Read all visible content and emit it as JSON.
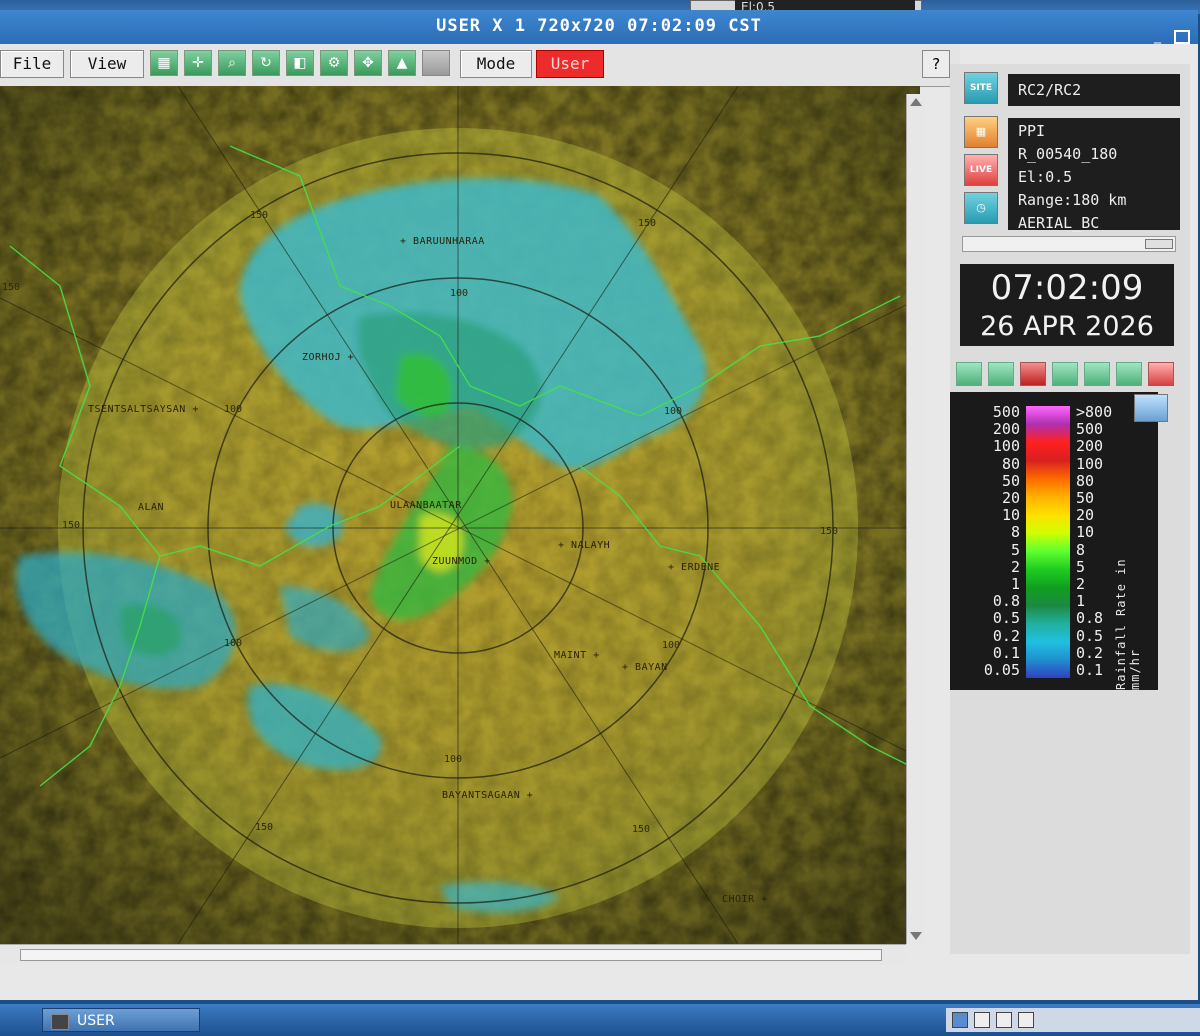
{
  "background": {
    "window_hint": "El:0.5"
  },
  "window": {
    "title": "USER  X 1  720x720   07:02:09 CST"
  },
  "toolbar": {
    "file_label": "File",
    "view_label": "View",
    "mode_label": "Mode",
    "mode_value": "User",
    "help_label": "?",
    "tool_icons": [
      "layers-icon",
      "crosshair-icon",
      "zoom-icon",
      "loop-icon",
      "overlay-icon",
      "measure-icon",
      "pan-icon",
      "terrain-icon",
      "blank-icon"
    ]
  },
  "map": {
    "range_rings": [
      {
        "label": "150",
        "pos": "nw"
      },
      {
        "label": "150",
        "pos": "ne"
      },
      {
        "label": "150",
        "pos": "w"
      },
      {
        "label": "150",
        "pos": "e"
      },
      {
        "label": "150",
        "pos": "sw"
      },
      {
        "label": "150",
        "pos": "se"
      },
      {
        "label": "100",
        "pos": "n"
      },
      {
        "label": "100",
        "pos": "w"
      },
      {
        "label": "100",
        "pos": "e"
      },
      {
        "label": "100",
        "pos": "sw"
      },
      {
        "label": "100",
        "pos": "se"
      },
      {
        "label": "100",
        "pos": "s"
      },
      {
        "label": "150",
        "pos": "far-w"
      }
    ],
    "cities": [
      {
        "name": "BARUUNHARAA"
      },
      {
        "name": "ZORHOJ"
      },
      {
        "name": "TSENTSALTSAYSAN"
      },
      {
        "name": "ALAN"
      },
      {
        "name": "ULAANBAATAR"
      },
      {
        "name": "ZUUNMOD"
      },
      {
        "name": "NALAYH"
      },
      {
        "name": "ERDENE"
      },
      {
        "name": "MAINT"
      },
      {
        "name": "BAYAN"
      },
      {
        "name": "BAYANTSAGAAN"
      },
      {
        "name": "CHOIR"
      }
    ]
  },
  "panel": {
    "product": "RC2/RC2",
    "info": [
      "PPI",
      "R_00540_180",
      "El:0.5",
      "Range:180 km",
      "AERIAL_BC"
    ],
    "clock_time": "07:02:09",
    "clock_date": "26 APR 2026",
    "icon_labels": {
      "site": "SITE",
      "live": "LIVE"
    },
    "controls": [
      "play-back-icon",
      "play-icon",
      "stop-icon",
      "step-back-icon",
      "step-forward-icon",
      "top-icon",
      "exit-icon"
    ]
  },
  "legend": {
    "left_values": [
      "500",
      "200",
      "100",
      "80",
      "50",
      "20",
      "10",
      "8",
      "5",
      "2",
      "1",
      "0.8",
      "0.5",
      "0.2",
      "0.1",
      "0.05"
    ],
    "right_values": [
      ">800",
      "500",
      "200",
      "100",
      "80",
      "50",
      "20",
      "10",
      "8",
      "5",
      "2",
      "1",
      "0.8",
      "0.5",
      "0.2",
      "0.1"
    ],
    "units": "Rainfall Rate in mm/hr",
    "colors": [
      "#ff66ff",
      "#b030b0",
      "#ff2020",
      "#d82020",
      "#ff6a00",
      "#ffb000",
      "#ffe000",
      "#d0ff00",
      "#60ff30",
      "#20cc20",
      "#10a020",
      "#1a8a40",
      "#20b0a0",
      "#20c0e0",
      "#2090d0",
      "#3040c0"
    ]
  },
  "taskbar": {
    "item": "USER"
  }
}
